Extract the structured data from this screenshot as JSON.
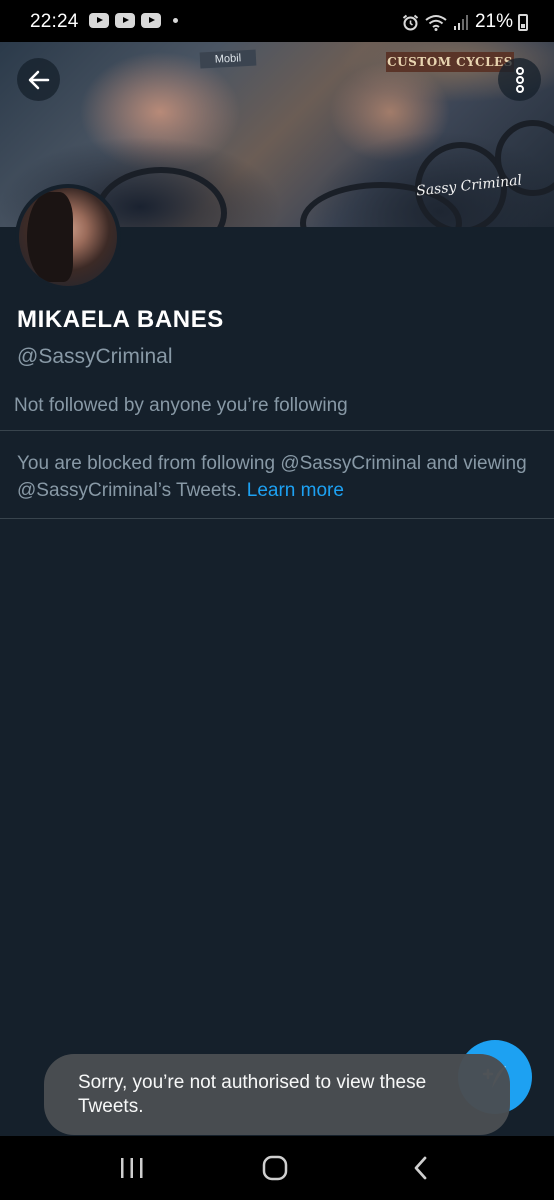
{
  "status_bar": {
    "time": "22:24",
    "battery_percent": "21%",
    "icons": [
      "youtube-icon",
      "youtube-icon",
      "youtube-icon",
      "notification-dot-icon",
      "alarm-icon",
      "wifi-icon",
      "signal-icon",
      "battery-charging-icon"
    ]
  },
  "header": {
    "banner": {
      "sign_text": "CUSTOM CYCLES",
      "mobil_text": "Mobil",
      "signature_text": "Sassy Criminal"
    },
    "back_icon": "arrow-left-icon",
    "more_icon": "more-vertical-icon"
  },
  "profile": {
    "display_name": "MIKAELA BANES",
    "handle": "@SassyCriminal",
    "followers_note": "Not followed by anyone you’re following",
    "blocked_message": "You are blocked from following @SassyCriminal and viewing @SassyCriminal’s Tweets.",
    "learn_more": "Learn more"
  },
  "fab": {
    "icon": "compose-tweet-icon"
  },
  "toast": {
    "message": "Sorry, you’re not authorised to view these Tweets."
  },
  "colors": {
    "background": "#15202b",
    "accent": "#1da1f2",
    "secondary_text": "#8899a6",
    "divider": "#38444d"
  }
}
